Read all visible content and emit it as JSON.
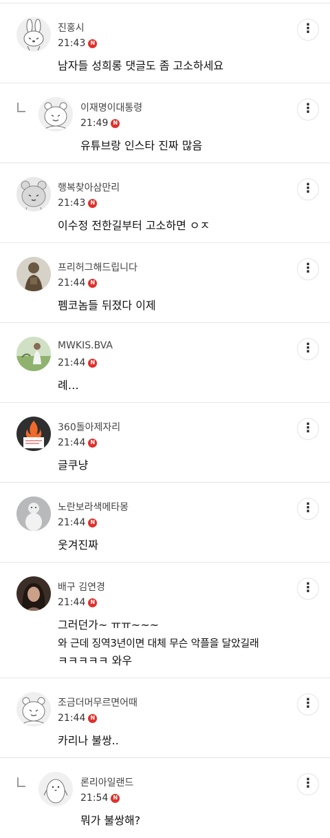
{
  "comments": [
    {
      "nick": "진홍시",
      "time": "21:43",
      "badge": "N",
      "text": [
        "남자들 성희롱 댓글도 좀 고소하세요"
      ],
      "avatar_icon": "rabbit-avatar-icon"
    },
    {
      "nick": "이재명이대통령",
      "time": "21:49",
      "badge": "N",
      "text": [
        "유튜브랑 인스타 진짜 많음"
      ],
      "avatar_icon": "bear-avatar-icon"
    },
    {
      "nick": "행복찾아삼만리",
      "time": "21:43",
      "badge": "N",
      "text": [
        "이수정 전한길부터 고소하면 ㅇㅈ"
      ],
      "avatar_icon": "bear-avatar-icon"
    },
    {
      "nick": "프리허그해드립니다",
      "time": "21:44",
      "badge": "N",
      "text": [
        "펨코놈들 뒤졌다 이제"
      ],
      "avatar_icon": "statue-photo-avatar"
    },
    {
      "nick": "MWKIS.BVA",
      "time": "21:44",
      "badge": "N",
      "text": [
        "례…"
      ],
      "avatar_icon": "person-photo-avatar"
    },
    {
      "nick": "360돌아제자리",
      "time": "21:44",
      "badge": "N",
      "text": [
        "글쿠냥"
      ],
      "avatar_icon": "flame-avatar-icon"
    },
    {
      "nick": "노란보라색메타몽",
      "time": "21:44",
      "badge": "N",
      "text": [
        "웃겨진짜"
      ],
      "avatar_icon": "snowman-photo-avatar"
    },
    {
      "nick": "배구 김연경",
      "time": "21:44",
      "badge": "N",
      "text": [
        "그러던가~ ㅠㅠ~~~",
        "와 근데 징역3년이면 대체 무슨 악플을 달았길래",
        "ㅋㅋㅋㅋㅋ 와우"
      ],
      "avatar_icon": "woman-photo-avatar"
    },
    {
      "nick": "조금더머무르면어때",
      "time": "21:44",
      "badge": "N",
      "text": [
        "카리나 불쌍.."
      ],
      "avatar_icon": "bear-avatar-icon"
    },
    {
      "nick": "론리아일랜드",
      "time": "21:54",
      "badge": "N",
      "text": [
        "뭐가 불쌍해?"
      ],
      "avatar_icon": "penguin-avatar-icon"
    }
  ],
  "more_icon": "⋮",
  "colors": {
    "badge": "#e0302b",
    "divider": "#e6e6e6"
  }
}
